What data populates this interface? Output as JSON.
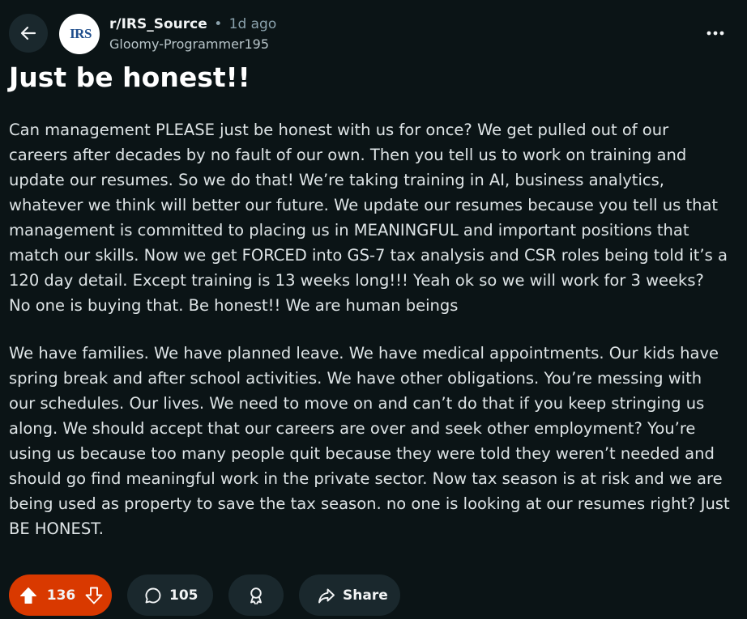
{
  "header": {
    "subreddit": "r/IRS_Source",
    "separator": "•",
    "time": "1d ago",
    "username": "Gloomy-Programmer195",
    "avatar_logo_text": "IRS"
  },
  "post": {
    "title": "Just be honest!!",
    "paragraphs": [
      "Can management PLEASE just be honest with us for once? We get pulled out of our careers after decades by no fault of our own. Then you tell us to work on training and update our resumes. So we do that! We’re taking training in AI, business analytics, whatever we think will better our future. We update our resumes because you tell us that management is committed to placing us in MEANINGFUL and important positions that match our skills. Now we get FORCED into GS-7 tax analysis and CSR roles being told it’s a 120 day detail. Except training is 13 weeks long!!! Yeah ok so we will work for 3 weeks? No one is buying that. Be honest!! We are human beings",
      "We have families. We have planned leave. We have medical appointments. Our kids have spring break and after school activities. We have other obligations. You’re messing with our schedules. Our lives. We need to move on and can’t do that if you keep stringing us along. We should accept that our careers are over and seek other employment? You’re using us because too many people quit because they were told they weren’t needed and should go find meaningful work in the private sector. Now tax season is at risk and we are being used as property to save the tax season. no one is looking at our resumes right? Just BE HONEST."
    ]
  },
  "actions": {
    "vote_count": "136",
    "comment_count": "105",
    "share_label": "Share"
  },
  "icons": {
    "back": "arrow-left-icon",
    "overflow": "more-horizontal-icon",
    "upvote": "upvote-filled-icon",
    "downvote": "downvote-outline-icon",
    "comment": "comment-bubble-icon",
    "award": "award-ribbon-icon",
    "share": "share-arrow-icon"
  },
  "colors": {
    "background": "#0b1416",
    "pill": "#1a282d",
    "upvoted": "#d93900",
    "text": "#f2f4f5",
    "muted": "#8ba2ad"
  }
}
